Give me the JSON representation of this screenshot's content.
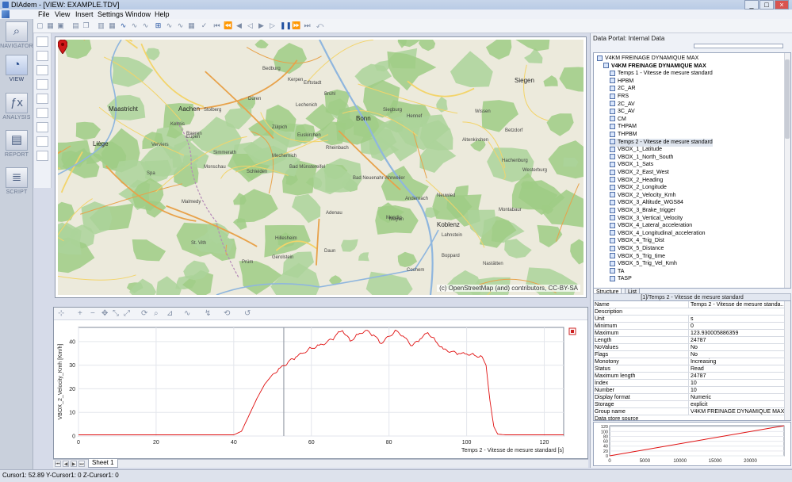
{
  "window": {
    "title": "DIAdem - [VIEW:  EXAMPLE.TDV]",
    "controls": [
      "_",
      "□",
      "×"
    ]
  },
  "menu": [
    "File",
    "View",
    "Insert",
    "Settings",
    "Window",
    "Help"
  ],
  "nav": [
    {
      "label": "NAVIGATOR",
      "icon": "navigator-icon",
      "glyph": "⌕"
    },
    {
      "label": "VIEW",
      "icon": "view-icon",
      "glyph": "◔",
      "selected": true
    },
    {
      "label": "ANALYSIS",
      "icon": "analysis-icon",
      "glyph": "ƒx"
    },
    {
      "label": "REPORT",
      "icon": "report-icon",
      "glyph": "▤"
    },
    {
      "label": "SCRIPT",
      "icon": "script-icon",
      "glyph": "≣"
    }
  ],
  "toolbar": {
    "buttons": [
      "new-icon",
      "open-icon",
      "save-icon",
      "print-icon",
      "copy-icon",
      "chart-icon",
      "cursor-icon",
      "band-icon",
      "zoom-icon",
      "pan-icon",
      "active-band-icon",
      "pointer-icon",
      "flag-icon",
      "skip-start-icon",
      "prev-icon",
      "step-back-icon",
      "play-back-icon",
      "play-icon",
      "pause-icon",
      "step-icon",
      "skip-end-icon",
      "loop-icon"
    ]
  },
  "map": {
    "attribution": "(c) OpenStreetMap (and) contributors, CC-BY-SA",
    "places": [
      {
        "name": "Maastricht",
        "city": true
      },
      {
        "name": "Aachen",
        "city": true
      },
      {
        "name": "Liège",
        "city": true
      },
      {
        "name": "Bonn",
        "city": true
      },
      {
        "name": "Siegen",
        "city": true
      },
      {
        "name": "Koblenz",
        "city": true
      },
      {
        "name": "Stolberg"
      },
      {
        "name": "Düren"
      },
      {
        "name": "Kerpen"
      },
      {
        "name": "Bedburg"
      },
      {
        "name": "Brühl"
      },
      {
        "name": "Euskirchen"
      },
      {
        "name": "Zülpich"
      },
      {
        "name": "Mechernich"
      },
      {
        "name": "Bad Münstereifel"
      },
      {
        "name": "Rheinbach"
      },
      {
        "name": "Monschau"
      },
      {
        "name": "Schleiden"
      },
      {
        "name": "Eupen"
      },
      {
        "name": "Verviers"
      },
      {
        "name": "Spa"
      },
      {
        "name": "Malmedy"
      },
      {
        "name": "Adenau"
      },
      {
        "name": "Mayen"
      },
      {
        "name": "Andernach"
      },
      {
        "name": "Neuwied"
      },
      {
        "name": "Montabaur"
      },
      {
        "name": "Hillesheim"
      },
      {
        "name": "Gerolstein"
      },
      {
        "name": "Prüm"
      },
      {
        "name": "Daun"
      },
      {
        "name": "Cochem"
      },
      {
        "name": "St. Vith"
      },
      {
        "name": "Bad Neuenahr-Ahrweiler"
      },
      {
        "name": "Siegburg"
      },
      {
        "name": "Hennef"
      },
      {
        "name": "Altenkirchen"
      },
      {
        "name": "Betzdorf"
      },
      {
        "name": "Wissen"
      },
      {
        "name": "Westerburg"
      },
      {
        "name": "Hachenburg"
      },
      {
        "name": "Simmerath"
      },
      {
        "name": "Kelmis"
      },
      {
        "name": "Raeren"
      },
      {
        "name": "Lechenich"
      },
      {
        "name": "Erftstadt"
      },
      {
        "name": "Mendig"
      },
      {
        "name": "Lahnstein"
      },
      {
        "name": "Boppard"
      },
      {
        "name": "Nastätten"
      }
    ]
  },
  "chart": {
    "toolbar": [
      "⊹",
      "+",
      "−",
      "✥",
      "⤡",
      "⤢",
      "⟳",
      "⌕",
      "⊿",
      "∿",
      "↯",
      "⟲",
      "↺"
    ],
    "sheet_tab": "Sheet 1"
  },
  "chart_data": {
    "type": "line",
    "xlabel": "Temps  2 - Vitesse de mesure standard [s]",
    "ylabel": "VBOX_2_Velocity_Kmh [Km/h]",
    "xlim": [
      0,
      125
    ],
    "ylim": [
      0,
      46
    ],
    "x_ticks": [
      0,
      20,
      40,
      60,
      80,
      100,
      120
    ],
    "y_ticks": [
      0,
      10,
      20,
      30,
      40
    ],
    "cursor_x": 52.89,
    "series": [
      {
        "color": "#e01010",
        "x": [
          0,
          20,
          40,
          42,
          44,
          46,
          48,
          50,
          52,
          54,
          56,
          58,
          60,
          62,
          64,
          66,
          67,
          68,
          70,
          72,
          74,
          76,
          78,
          80,
          82,
          84,
          86,
          88,
          90,
          92,
          94,
          96,
          98,
          100,
          102,
          104,
          105,
          106,
          107,
          108,
          110,
          115,
          125
        ],
        "y": [
          0.5,
          0.5,
          0.5,
          2,
          9,
          16,
          22,
          26,
          29,
          31.5,
          33.5,
          35,
          37,
          38.5,
          40,
          42,
          45,
          44.5,
          40,
          43,
          45,
          43,
          39,
          42,
          44.5,
          42,
          38.5,
          41,
          43.5,
          40,
          37,
          36,
          35,
          34.5,
          34,
          33.5,
          30,
          15,
          4,
          0.8,
          0.5,
          0.5,
          0.5
        ]
      }
    ]
  },
  "portal": {
    "title": "Data Portal: Internal Data",
    "tree": [
      {
        "label": "V4KM FREINAGE DYNAMIQUE MAX",
        "level": 0
      },
      {
        "label": "V4KM FREINAGE DYNAMIQUE MAX",
        "level": 1,
        "bold": true
      },
      {
        "label": "Temps  1 - Vitesse de mesure standard",
        "level": 2
      },
      {
        "label": "HPBM",
        "level": 2
      },
      {
        "label": "2C_AR",
        "level": 2
      },
      {
        "label": "FRS",
        "level": 2
      },
      {
        "label": "2C_AV",
        "level": 2
      },
      {
        "label": "3C_AV",
        "level": 2
      },
      {
        "label": "CM",
        "level": 2
      },
      {
        "label": "THPAM",
        "level": 2
      },
      {
        "label": "THPBM",
        "level": 2
      },
      {
        "label": "Temps  2 - Vitesse de mesure standard",
        "level": 2,
        "selected": true
      },
      {
        "label": "VBOX_1_Latitude",
        "level": 2
      },
      {
        "label": "VBOX_1_North_South",
        "level": 2
      },
      {
        "label": "VBOX_1_Sats",
        "level": 2
      },
      {
        "label": "VBOX_2_East_West",
        "level": 2
      },
      {
        "label": "VBOX_2_Heading",
        "level": 2
      },
      {
        "label": "VBOX_2_Longitude",
        "level": 2
      },
      {
        "label": "VBOX_2_Velocity_Kmh",
        "level": 2
      },
      {
        "label": "VBOX_3_Altitude_WGS84",
        "level": 2
      },
      {
        "label": "VBOX_3_Brake_trigger",
        "level": 2
      },
      {
        "label": "VBOX_3_Vertical_Velocity",
        "level": 2
      },
      {
        "label": "VBOX_4_Lateral_acceleration",
        "level": 2
      },
      {
        "label": "VBOX_4_Longitudinal_acceleration",
        "level": 2
      },
      {
        "label": "VBOX_4_Trig_Dist",
        "level": 2
      },
      {
        "label": "VBOX_5_Distance",
        "level": 2
      },
      {
        "label": "VBOX_5_Trig_time",
        "level": 2
      },
      {
        "label": "VBOX_5_Trig_Vel_Kmh",
        "level": 2
      },
      {
        "label": "TA",
        "level": 2
      },
      {
        "label": "TASP",
        "level": 2
      }
    ],
    "tabs": [
      "Structure",
      "List"
    ],
    "prop_header": "[1]/Temps  2 - Vitesse de mesure standard",
    "properties": [
      [
        "Name",
        "Temps  2 - Vitesse de mesure standa..."
      ],
      [
        "Description",
        ""
      ],
      [
        "Unit",
        "s"
      ],
      [
        "Minimum",
        "0"
      ],
      [
        "Maximum",
        "123.930005886359"
      ],
      [
        "Length",
        "24787"
      ],
      [
        "NoValues",
        "No"
      ],
      [
        "Flags",
        "No"
      ],
      [
        "Monotony",
        "Increasing"
      ],
      [
        "Status",
        "Read"
      ],
      [
        "Maximum length",
        "24787"
      ],
      [
        "Index",
        "10"
      ],
      [
        "Number",
        "10"
      ],
      [
        "Display format",
        "Numeric"
      ],
      [
        "Storage",
        "explicit"
      ],
      [
        "Group name",
        "V4KM FREINAGE DYNAMIQUE MAX"
      ],
      [
        "Data store source",
        ""
      ]
    ],
    "mini_chart": {
      "x_ticks": [
        0,
        5000,
        10000,
        15000,
        20000
      ],
      "y_ticks": [
        0,
        20,
        40,
        60,
        80,
        100,
        120
      ],
      "xlim": [
        0,
        24787
      ],
      "ylim": [
        0,
        124
      ]
    }
  },
  "status": "Cursor1: 52.89  Y-Cursor1: 0  Z-Cursor1: 0"
}
